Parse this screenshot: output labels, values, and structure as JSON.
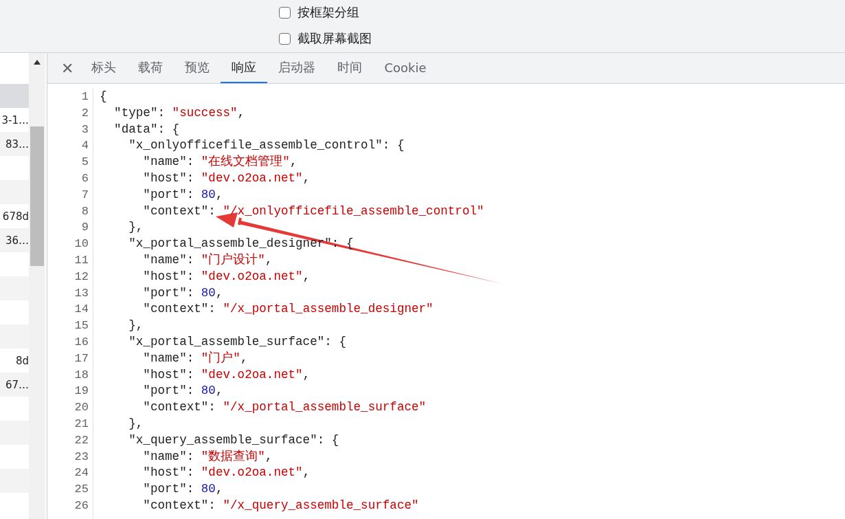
{
  "options": [
    {
      "label": "按框架分组",
      "checked": false
    },
    {
      "label": "截取屏幕截图",
      "checked": false
    }
  ],
  "request_list": {
    "rows": [
      {
        "text": "",
        "selected": true
      },
      {
        "text": "3-1…",
        "selected": false
      },
      {
        "text": "83…",
        "selected": false
      },
      {
        "text": "",
        "selected": false
      },
      {
        "text": "",
        "selected": false
      },
      {
        "text": "678d",
        "selected": false
      },
      {
        "text": "36…",
        "selected": false
      },
      {
        "text": "",
        "selected": false
      },
      {
        "text": "",
        "selected": false
      },
      {
        "text": "",
        "selected": false
      },
      {
        "text": "",
        "selected": false
      },
      {
        "text": "8d",
        "selected": false
      },
      {
        "text": "67…",
        "selected": false
      },
      {
        "text": "",
        "selected": false
      },
      {
        "text": "",
        "selected": false
      },
      {
        "text": "",
        "selected": false
      },
      {
        "text": "",
        "selected": false
      }
    ]
  },
  "close_button": {
    "label": "✕"
  },
  "tabs": [
    {
      "label": "标头",
      "selected": false
    },
    {
      "label": "载荷",
      "selected": false
    },
    {
      "label": "预览",
      "selected": false
    },
    {
      "label": "响应",
      "selected": true
    },
    {
      "label": "启动器",
      "selected": false
    },
    {
      "label": "时间",
      "selected": false
    },
    {
      "label": "Cookie",
      "selected": false
    }
  ],
  "code_lines": [
    {
      "number": "1",
      "tokens": [
        {
          "kind": "punct",
          "text": "{"
        }
      ]
    },
    {
      "number": "2",
      "tokens": [
        {
          "kind": "punct",
          "text": "  \"type\": "
        },
        {
          "kind": "string",
          "text": "\"success\""
        },
        {
          "kind": "punct",
          "text": ","
        }
      ]
    },
    {
      "number": "3",
      "tokens": [
        {
          "kind": "punct",
          "text": "  \"data\": {"
        }
      ]
    },
    {
      "number": "4",
      "tokens": [
        {
          "kind": "punct",
          "text": "    \"x_onlyofficefile_assemble_control\": {"
        }
      ]
    },
    {
      "number": "5",
      "tokens": [
        {
          "kind": "punct",
          "text": "      \"name\": "
        },
        {
          "kind": "string",
          "text": "\"在线文档管理\""
        },
        {
          "kind": "punct",
          "text": ","
        }
      ]
    },
    {
      "number": "6",
      "tokens": [
        {
          "kind": "punct",
          "text": "      \"host\": "
        },
        {
          "kind": "string",
          "text": "\"dev.o2oa.net\""
        },
        {
          "kind": "punct",
          "text": ","
        }
      ]
    },
    {
      "number": "7",
      "tokens": [
        {
          "kind": "punct",
          "text": "      \"port\": "
        },
        {
          "kind": "number",
          "text": "80"
        },
        {
          "kind": "punct",
          "text": ","
        }
      ]
    },
    {
      "number": "8",
      "tokens": [
        {
          "kind": "punct",
          "text": "      \"context\": "
        },
        {
          "kind": "string",
          "text": "\"/x_onlyofficefile_assemble_control\""
        }
      ]
    },
    {
      "number": "9",
      "tokens": [
        {
          "kind": "punct",
          "text": "    },"
        }
      ]
    },
    {
      "number": "10",
      "tokens": [
        {
          "kind": "punct",
          "text": "    \"x_portal_assemble_designer\": {"
        }
      ]
    },
    {
      "number": "11",
      "tokens": [
        {
          "kind": "punct",
          "text": "      \"name\": "
        },
        {
          "kind": "string",
          "text": "\"门户设计\""
        },
        {
          "kind": "punct",
          "text": ","
        }
      ]
    },
    {
      "number": "12",
      "tokens": [
        {
          "kind": "punct",
          "text": "      \"host\": "
        },
        {
          "kind": "string",
          "text": "\"dev.o2oa.net\""
        },
        {
          "kind": "punct",
          "text": ","
        }
      ]
    },
    {
      "number": "13",
      "tokens": [
        {
          "kind": "punct",
          "text": "      \"port\": "
        },
        {
          "kind": "number",
          "text": "80"
        },
        {
          "kind": "punct",
          "text": ","
        }
      ]
    },
    {
      "number": "14",
      "tokens": [
        {
          "kind": "punct",
          "text": "      \"context\": "
        },
        {
          "kind": "string",
          "text": "\"/x_portal_assemble_designer\""
        }
      ]
    },
    {
      "number": "15",
      "tokens": [
        {
          "kind": "punct",
          "text": "    },"
        }
      ]
    },
    {
      "number": "16",
      "tokens": [
        {
          "kind": "punct",
          "text": "    \"x_portal_assemble_surface\": {"
        }
      ]
    },
    {
      "number": "17",
      "tokens": [
        {
          "kind": "punct",
          "text": "      \"name\": "
        },
        {
          "kind": "string",
          "text": "\"门户\""
        },
        {
          "kind": "punct",
          "text": ","
        }
      ]
    },
    {
      "number": "18",
      "tokens": [
        {
          "kind": "punct",
          "text": "      \"host\": "
        },
        {
          "kind": "string",
          "text": "\"dev.o2oa.net\""
        },
        {
          "kind": "punct",
          "text": ","
        }
      ]
    },
    {
      "number": "19",
      "tokens": [
        {
          "kind": "punct",
          "text": "      \"port\": "
        },
        {
          "kind": "number",
          "text": "80"
        },
        {
          "kind": "punct",
          "text": ","
        }
      ]
    },
    {
      "number": "20",
      "tokens": [
        {
          "kind": "punct",
          "text": "      \"context\": "
        },
        {
          "kind": "string",
          "text": "\"/x_portal_assemble_surface\""
        }
      ]
    },
    {
      "number": "21",
      "tokens": [
        {
          "kind": "punct",
          "text": "    },"
        }
      ]
    },
    {
      "number": "22",
      "tokens": [
        {
          "kind": "punct",
          "text": "    \"x_query_assemble_surface\": {"
        }
      ]
    },
    {
      "number": "23",
      "tokens": [
        {
          "kind": "punct",
          "text": "      \"name\": "
        },
        {
          "kind": "string",
          "text": "\"数据查询\""
        },
        {
          "kind": "punct",
          "text": ","
        }
      ]
    },
    {
      "number": "24",
      "tokens": [
        {
          "kind": "punct",
          "text": "      \"host\": "
        },
        {
          "kind": "string",
          "text": "\"dev.o2oa.net\""
        },
        {
          "kind": "punct",
          "text": ","
        }
      ]
    },
    {
      "number": "25",
      "tokens": [
        {
          "kind": "punct",
          "text": "      \"port\": "
        },
        {
          "kind": "number",
          "text": "80"
        },
        {
          "kind": "punct",
          "text": ","
        }
      ]
    },
    {
      "number": "26",
      "tokens": [
        {
          "kind": "punct",
          "text": "      \"context\": "
        },
        {
          "kind": "string",
          "text": "\"/x_query_assemble_surface\""
        }
      ]
    }
  ]
}
